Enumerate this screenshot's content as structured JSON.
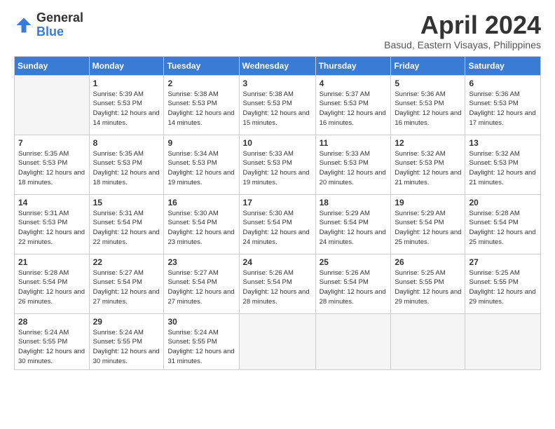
{
  "logo": {
    "general": "General",
    "blue": "Blue"
  },
  "header": {
    "month": "April 2024",
    "location": "Basud, Eastern Visayas, Philippines"
  },
  "weekdays": [
    "Sunday",
    "Monday",
    "Tuesday",
    "Wednesday",
    "Thursday",
    "Friday",
    "Saturday"
  ],
  "weeks": [
    [
      {
        "day": null,
        "info": null
      },
      {
        "day": "1",
        "sunrise": "5:39 AM",
        "sunset": "5:53 PM",
        "daylight": "12 hours and 14 minutes."
      },
      {
        "day": "2",
        "sunrise": "5:38 AM",
        "sunset": "5:53 PM",
        "daylight": "12 hours and 14 minutes."
      },
      {
        "day": "3",
        "sunrise": "5:38 AM",
        "sunset": "5:53 PM",
        "daylight": "12 hours and 15 minutes."
      },
      {
        "day": "4",
        "sunrise": "5:37 AM",
        "sunset": "5:53 PM",
        "daylight": "12 hours and 16 minutes."
      },
      {
        "day": "5",
        "sunrise": "5:36 AM",
        "sunset": "5:53 PM",
        "daylight": "12 hours and 16 minutes."
      },
      {
        "day": "6",
        "sunrise": "5:36 AM",
        "sunset": "5:53 PM",
        "daylight": "12 hours and 17 minutes."
      }
    ],
    [
      {
        "day": "7",
        "sunrise": "5:35 AM",
        "sunset": "5:53 PM",
        "daylight": "12 hours and 18 minutes."
      },
      {
        "day": "8",
        "sunrise": "5:35 AM",
        "sunset": "5:53 PM",
        "daylight": "12 hours and 18 minutes."
      },
      {
        "day": "9",
        "sunrise": "5:34 AM",
        "sunset": "5:53 PM",
        "daylight": "12 hours and 19 minutes."
      },
      {
        "day": "10",
        "sunrise": "5:33 AM",
        "sunset": "5:53 PM",
        "daylight": "12 hours and 19 minutes."
      },
      {
        "day": "11",
        "sunrise": "5:33 AM",
        "sunset": "5:53 PM",
        "daylight": "12 hours and 20 minutes."
      },
      {
        "day": "12",
        "sunrise": "5:32 AM",
        "sunset": "5:53 PM",
        "daylight": "12 hours and 21 minutes."
      },
      {
        "day": "13",
        "sunrise": "5:32 AM",
        "sunset": "5:53 PM",
        "daylight": "12 hours and 21 minutes."
      }
    ],
    [
      {
        "day": "14",
        "sunrise": "5:31 AM",
        "sunset": "5:53 PM",
        "daylight": "12 hours and 22 minutes."
      },
      {
        "day": "15",
        "sunrise": "5:31 AM",
        "sunset": "5:54 PM",
        "daylight": "12 hours and 22 minutes."
      },
      {
        "day": "16",
        "sunrise": "5:30 AM",
        "sunset": "5:54 PM",
        "daylight": "12 hours and 23 minutes."
      },
      {
        "day": "17",
        "sunrise": "5:30 AM",
        "sunset": "5:54 PM",
        "daylight": "12 hours and 24 minutes."
      },
      {
        "day": "18",
        "sunrise": "5:29 AM",
        "sunset": "5:54 PM",
        "daylight": "12 hours and 24 minutes."
      },
      {
        "day": "19",
        "sunrise": "5:29 AM",
        "sunset": "5:54 PM",
        "daylight": "12 hours and 25 minutes."
      },
      {
        "day": "20",
        "sunrise": "5:28 AM",
        "sunset": "5:54 PM",
        "daylight": "12 hours and 25 minutes."
      }
    ],
    [
      {
        "day": "21",
        "sunrise": "5:28 AM",
        "sunset": "5:54 PM",
        "daylight": "12 hours and 26 minutes."
      },
      {
        "day": "22",
        "sunrise": "5:27 AM",
        "sunset": "5:54 PM",
        "daylight": "12 hours and 27 minutes."
      },
      {
        "day": "23",
        "sunrise": "5:27 AM",
        "sunset": "5:54 PM",
        "daylight": "12 hours and 27 minutes."
      },
      {
        "day": "24",
        "sunrise": "5:26 AM",
        "sunset": "5:54 PM",
        "daylight": "12 hours and 28 minutes."
      },
      {
        "day": "25",
        "sunrise": "5:26 AM",
        "sunset": "5:54 PM",
        "daylight": "12 hours and 28 minutes."
      },
      {
        "day": "26",
        "sunrise": "5:25 AM",
        "sunset": "5:55 PM",
        "daylight": "12 hours and 29 minutes."
      },
      {
        "day": "27",
        "sunrise": "5:25 AM",
        "sunset": "5:55 PM",
        "daylight": "12 hours and 29 minutes."
      }
    ],
    [
      {
        "day": "28",
        "sunrise": "5:24 AM",
        "sunset": "5:55 PM",
        "daylight": "12 hours and 30 minutes."
      },
      {
        "day": "29",
        "sunrise": "5:24 AM",
        "sunset": "5:55 PM",
        "daylight": "12 hours and 30 minutes."
      },
      {
        "day": "30",
        "sunrise": "5:24 AM",
        "sunset": "5:55 PM",
        "daylight": "12 hours and 31 minutes."
      },
      {
        "day": null,
        "info": null
      },
      {
        "day": null,
        "info": null
      },
      {
        "day": null,
        "info": null
      },
      {
        "day": null,
        "info": null
      }
    ]
  ]
}
